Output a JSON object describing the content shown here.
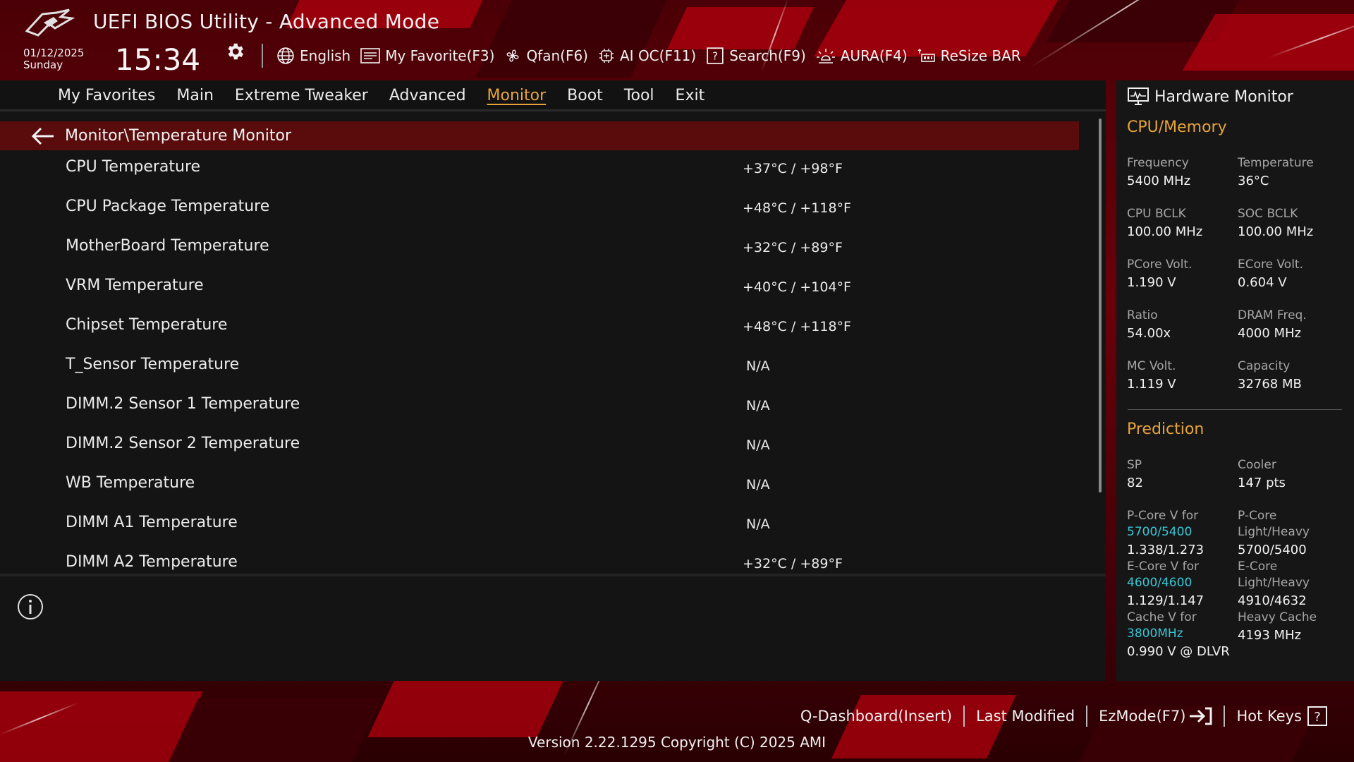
{
  "app": {
    "title": "UEFI BIOS Utility - Advanced Mode"
  },
  "datetime": {
    "date": "01/12/2025",
    "day": "Sunday",
    "time": "15:34"
  },
  "toolbar": {
    "language": "English",
    "favorite": "My Favorite(F3)",
    "qfan": "Qfan(F6)",
    "aioc": "AI OC(F11)",
    "search": "Search(F9)",
    "aura": "AURA(F4)",
    "resizebar": "ReSize BAR"
  },
  "nav": {
    "tabs": [
      "My Favorites",
      "Main",
      "Extreme Tweaker",
      "Advanced",
      "Monitor",
      "Boot",
      "Tool",
      "Exit"
    ],
    "active": "Monitor"
  },
  "breadcrumb": "Monitor\\Temperature Monitor",
  "rows": [
    {
      "name": "CPU Temperature",
      "value": "+37°C / +98°F"
    },
    {
      "name": "CPU Package Temperature",
      "value": "+48°C / +118°F"
    },
    {
      "name": "MotherBoard Temperature",
      "value": "+32°C / +89°F"
    },
    {
      "name": "VRM Temperature",
      "value": "+40°C / +104°F"
    },
    {
      "name": "Chipset Temperature",
      "value": "+48°C / +118°F"
    },
    {
      "name": "T_Sensor Temperature",
      "value": "N/A"
    },
    {
      "name": "DIMM.2 Sensor 1 Temperature",
      "value": "N/A"
    },
    {
      "name": "DIMM.2 Sensor 2 Temperature",
      "value": "N/A"
    },
    {
      "name": "WB Temperature",
      "value": "N/A"
    },
    {
      "name": "DIMM A1 Temperature",
      "value": "N/A"
    },
    {
      "name": "DIMM A2 Temperature",
      "value": "+32°C / +89°F"
    }
  ],
  "hw": {
    "title": "Hardware Monitor",
    "cpu_section": "CPU/Memory",
    "cpu": [
      {
        "label": "Frequency",
        "value": "5400 MHz"
      },
      {
        "label": "Temperature",
        "value": "36°C"
      },
      {
        "label": "CPU BCLK",
        "value": "100.00 MHz"
      },
      {
        "label": "SOC BCLK",
        "value": "100.00 MHz"
      },
      {
        "label": "PCore Volt.",
        "value": "1.190 V"
      },
      {
        "label": "ECore Volt.",
        "value": "0.604 V"
      },
      {
        "label": "Ratio",
        "value": "54.00x"
      },
      {
        "label": "DRAM Freq.",
        "value": "4000 MHz"
      },
      {
        "label": "MC Volt.",
        "value": "1.119 V"
      },
      {
        "label": "Capacity",
        "value": "32768 MB"
      }
    ],
    "pred_section": "Prediction",
    "sp": {
      "label": "SP",
      "value": "82"
    },
    "cooler": {
      "label": "Cooler",
      "value": "147 pts"
    },
    "pcore_v": {
      "label": "P-Core V for",
      "freq": "5700/5400",
      "value": "1.338/1.273"
    },
    "pcore_lh": {
      "label1": "P-Core",
      "label2": "Light/Heavy",
      "value": "5700/5400"
    },
    "ecore_v": {
      "label": "E-Core V for",
      "freq": "4600/4600",
      "value": "1.129/1.147"
    },
    "ecore_lh": {
      "label1": "E-Core",
      "label2": "Light/Heavy",
      "value": "4910/4632"
    },
    "cache_v": {
      "label": "Cache V for",
      "freq": "3800MHz",
      "value": "0.990 V @ DLVR"
    },
    "heavy_cache": {
      "label": "Heavy Cache",
      "value": "4193 MHz"
    }
  },
  "footer": {
    "qdashboard": "Q-Dashboard(Insert)",
    "last_modified": "Last Modified",
    "ezmode": "EzMode(F7)",
    "hotkeys": "Hot Keys",
    "version": "Version 2.22.1295 Copyright (C) 2025 AMI"
  },
  "colors": {
    "accent": "#e8a43a",
    "cyan": "#38c6d6",
    "crumb": "#5a0c0c",
    "bg_red": "#b3000e"
  }
}
